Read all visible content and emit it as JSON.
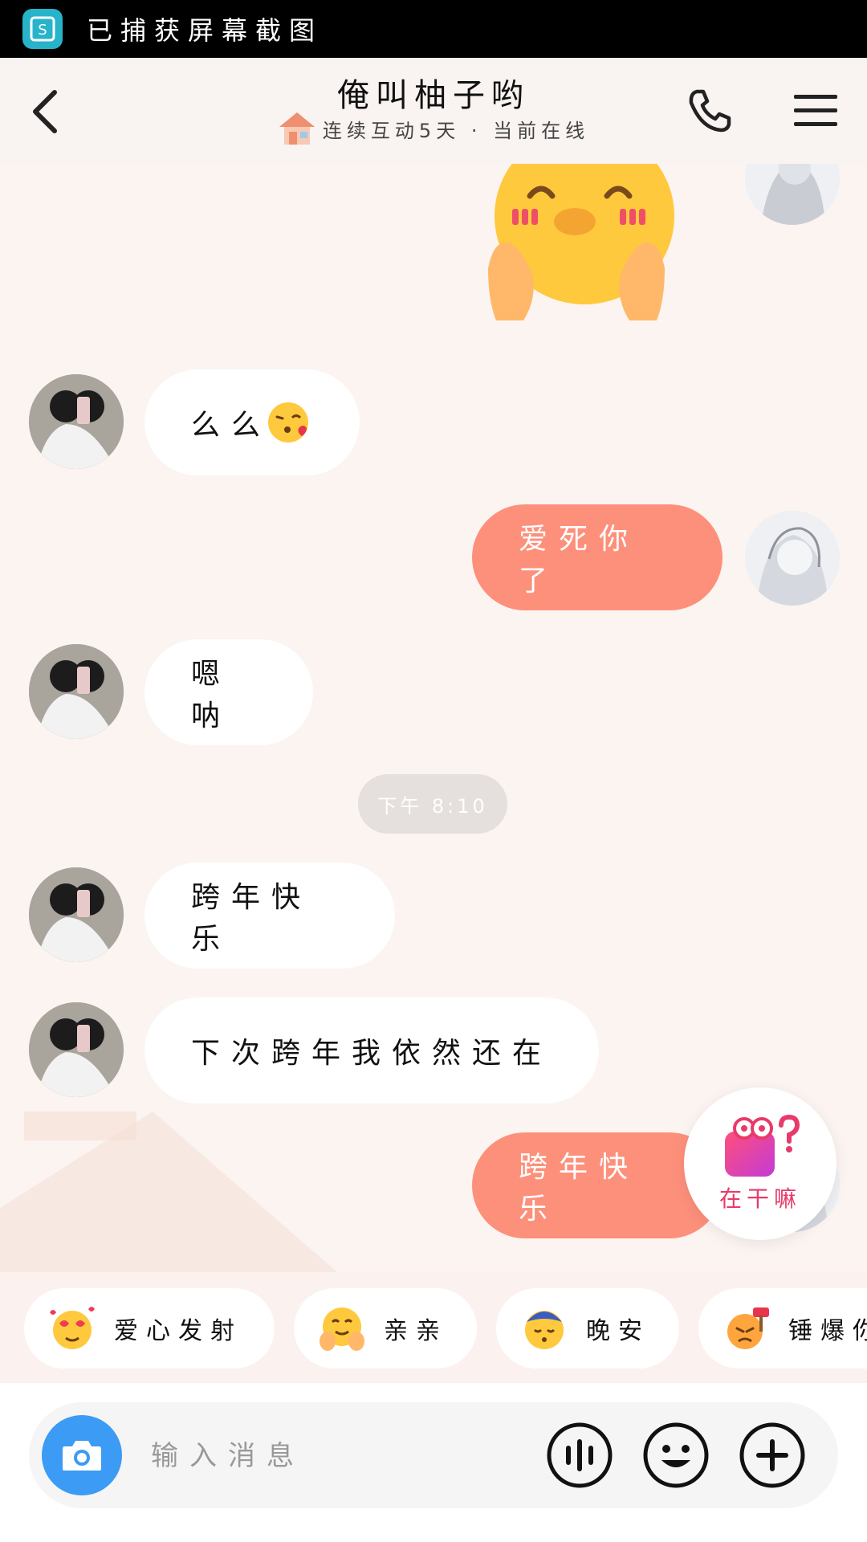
{
  "status_bar": {
    "text": "已捕获屏幕截图",
    "app_icon": "screenshot-app-icon"
  },
  "header": {
    "title": "俺叫柚子哟",
    "subtitle": "连续互动5天 · 当前在线",
    "icons": [
      "back-icon",
      "house-icon",
      "phone-icon",
      "menu-icon"
    ]
  },
  "messages": [
    {
      "side": "right",
      "type": "sticker",
      "sticker": "blushing-face-sticker"
    },
    {
      "side": "left",
      "type": "text",
      "text": "么么",
      "emoji": "kissing-face-emoji"
    },
    {
      "side": "right",
      "type": "text",
      "text": "爱死你了"
    },
    {
      "side": "left",
      "type": "text",
      "text": "嗯呐"
    },
    {
      "type": "time",
      "text": "下午 8:10"
    },
    {
      "side": "left",
      "type": "text",
      "text": "跨年快乐"
    },
    {
      "side": "left",
      "type": "text",
      "text": "下次跨年我依然还在"
    },
    {
      "side": "right",
      "type": "text",
      "text": "跨年快乐"
    }
  ],
  "floating_button": {
    "label": "在干嘛",
    "icon": "camera-question-icon"
  },
  "quick_replies": [
    {
      "label": "爱心发射",
      "icon": "love-hearts-emoji"
    },
    {
      "label": "亲亲",
      "icon": "hug-emoji"
    },
    {
      "label": "晚安",
      "icon": "sleep-emoji"
    },
    {
      "label": "锤爆你",
      "icon": "hammer-emoji"
    }
  ],
  "input": {
    "placeholder": "输入消息"
  },
  "toolbar_icons": [
    "camera-icon",
    "voice-icon",
    "emoji-icon",
    "plus-icon"
  ],
  "colors": {
    "accent": "#fd907b",
    "background": "#fbf4f1",
    "camera_button": "#3b9bf5"
  }
}
